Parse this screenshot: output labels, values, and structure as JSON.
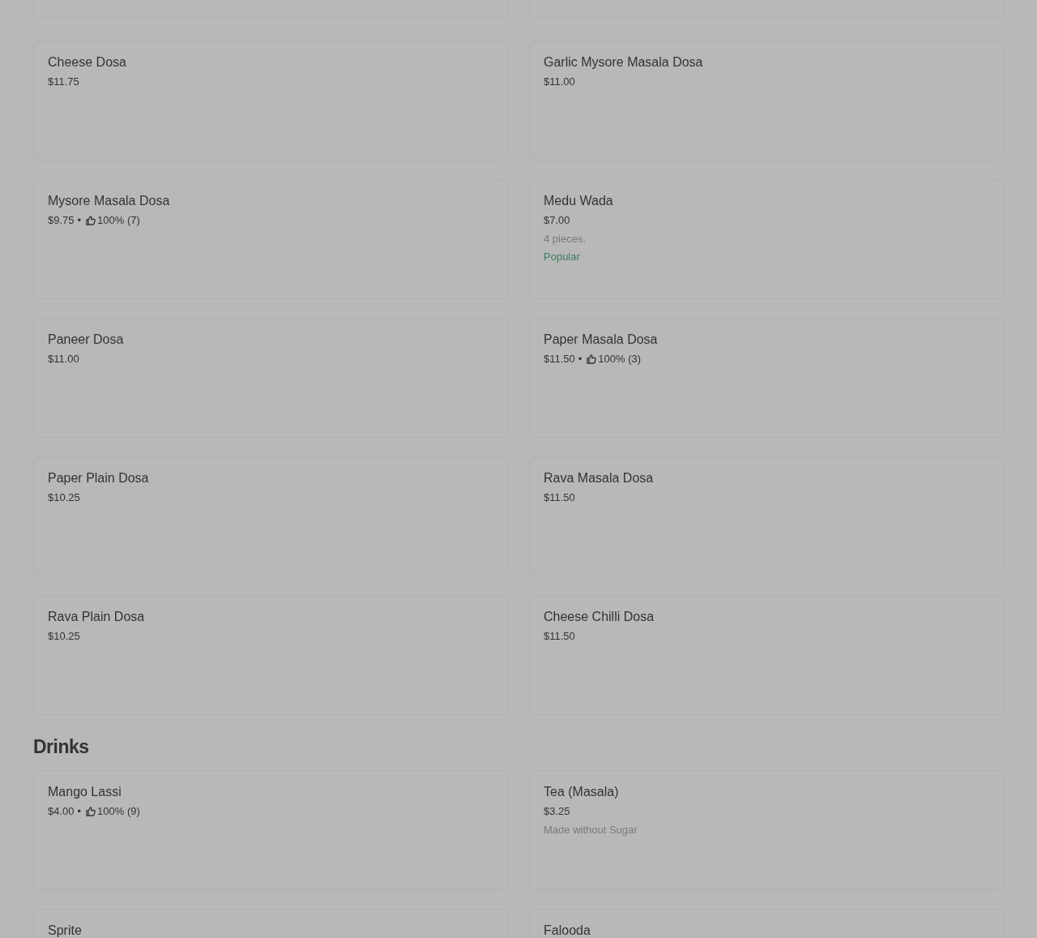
{
  "sections": [
    {
      "items": [
        {
          "name": "Cheese Dosa",
          "price": "$11.75"
        },
        {
          "name": "Garlic Mysore Masala Dosa",
          "price": "$11.00"
        },
        {
          "name": "Mysore Masala Dosa",
          "price": "$9.75",
          "separator": "•",
          "rating": "100% (7)"
        },
        {
          "name": "Medu Wada",
          "price": "$7.00",
          "description": "4 pieces.",
          "badge": "Popular"
        },
        {
          "name": "Paneer Dosa",
          "price": "$11.00"
        },
        {
          "name": "Paper Masala Dosa",
          "price": "$11.50",
          "separator": "•",
          "rating": "100% (3)"
        },
        {
          "name": "Paper Plain Dosa",
          "price": "$10.25"
        },
        {
          "name": "Rava Masala Dosa",
          "price": "$11.50"
        },
        {
          "name": "Rava Plain Dosa",
          "price": "$10.25"
        },
        {
          "name": "Cheese Chilli Dosa",
          "price": "$11.50"
        }
      ]
    },
    {
      "title": "Drinks",
      "items": [
        {
          "name": "Mango Lassi",
          "price": "$4.00",
          "separator": "•",
          "rating": "100% (9)"
        },
        {
          "name": "Tea (Masala)",
          "price": "$3.25",
          "description": "Made without Sugar"
        },
        {
          "name": "Sprite"
        },
        {
          "name": "Falooda"
        }
      ]
    }
  ]
}
